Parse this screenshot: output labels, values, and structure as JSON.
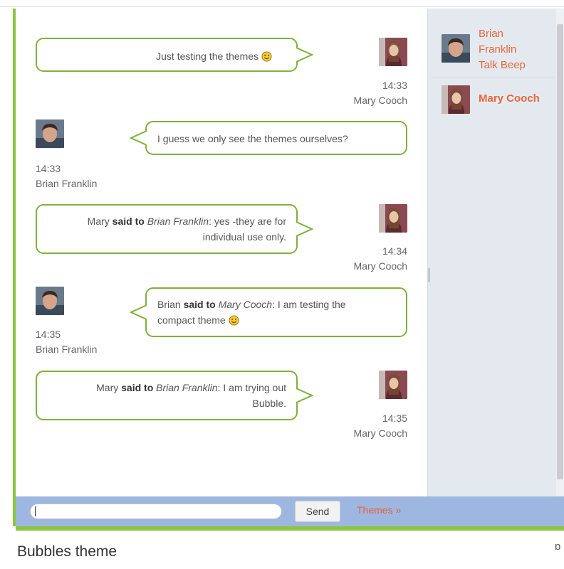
{
  "messages": [
    {
      "sender": "Mary Cooch",
      "time": "14:33",
      "side": "right",
      "parts": [
        {
          "t": "Just testing the themes "
        }
      ],
      "emoji": true
    },
    {
      "sender": "Brian Franklin",
      "time": "14:33",
      "side": "left",
      "parts": [
        {
          "t": "I guess we only see the themes ourselves?"
        }
      ],
      "emoji": false
    },
    {
      "sender": "Mary Cooch",
      "time": "14:34",
      "side": "right",
      "parts": [
        {
          "t": "Mary "
        },
        {
          "t": "said to",
          "b": true
        },
        {
          "t": " "
        },
        {
          "t": "Brian Franklin",
          "i": true
        },
        {
          "t": ": yes -they are for individual use only."
        }
      ],
      "emoji": false
    },
    {
      "sender": "Brian Franklin",
      "time": "14:35",
      "side": "left",
      "parts": [
        {
          "t": "Brian "
        },
        {
          "t": "said to",
          "b": true
        },
        {
          "t": " "
        },
        {
          "t": "Mary Cooch",
          "i": true
        },
        {
          "t": ": I am testing the compact theme "
        }
      ],
      "emoji": true
    },
    {
      "sender": "Mary Cooch",
      "time": "14:35",
      "side": "right",
      "parts": [
        {
          "t": "Mary "
        },
        {
          "t": "said to",
          "b": true
        },
        {
          "t": " "
        },
        {
          "t": "Brian Franklin",
          "i": true
        },
        {
          "t": ": I am trying out Bubble."
        }
      ],
      "emoji": false
    }
  ],
  "users": {
    "brian": {
      "name_lines": [
        "Brian",
        "Franklin",
        "Talk Beep"
      ]
    },
    "mary": {
      "name": "Mary Cooch"
    }
  },
  "composer": {
    "input_value": "",
    "send_label": "Send",
    "themes_link": "Themes »"
  },
  "caption": "Bubbles theme",
  "corner_icon": "ɒ",
  "colors": {
    "accent_green": "#8cc63f",
    "bubble_border": "#7fb23a",
    "link_orange": "#ea5b3f",
    "composer_blue": "#9eb7e0",
    "sidebar_bg": "#e4e9f0"
  },
  "icons": {
    "emoji": "smiley-icon",
    "mary_avatar": "mary-avatar",
    "brian_avatar": "brian-avatar"
  }
}
